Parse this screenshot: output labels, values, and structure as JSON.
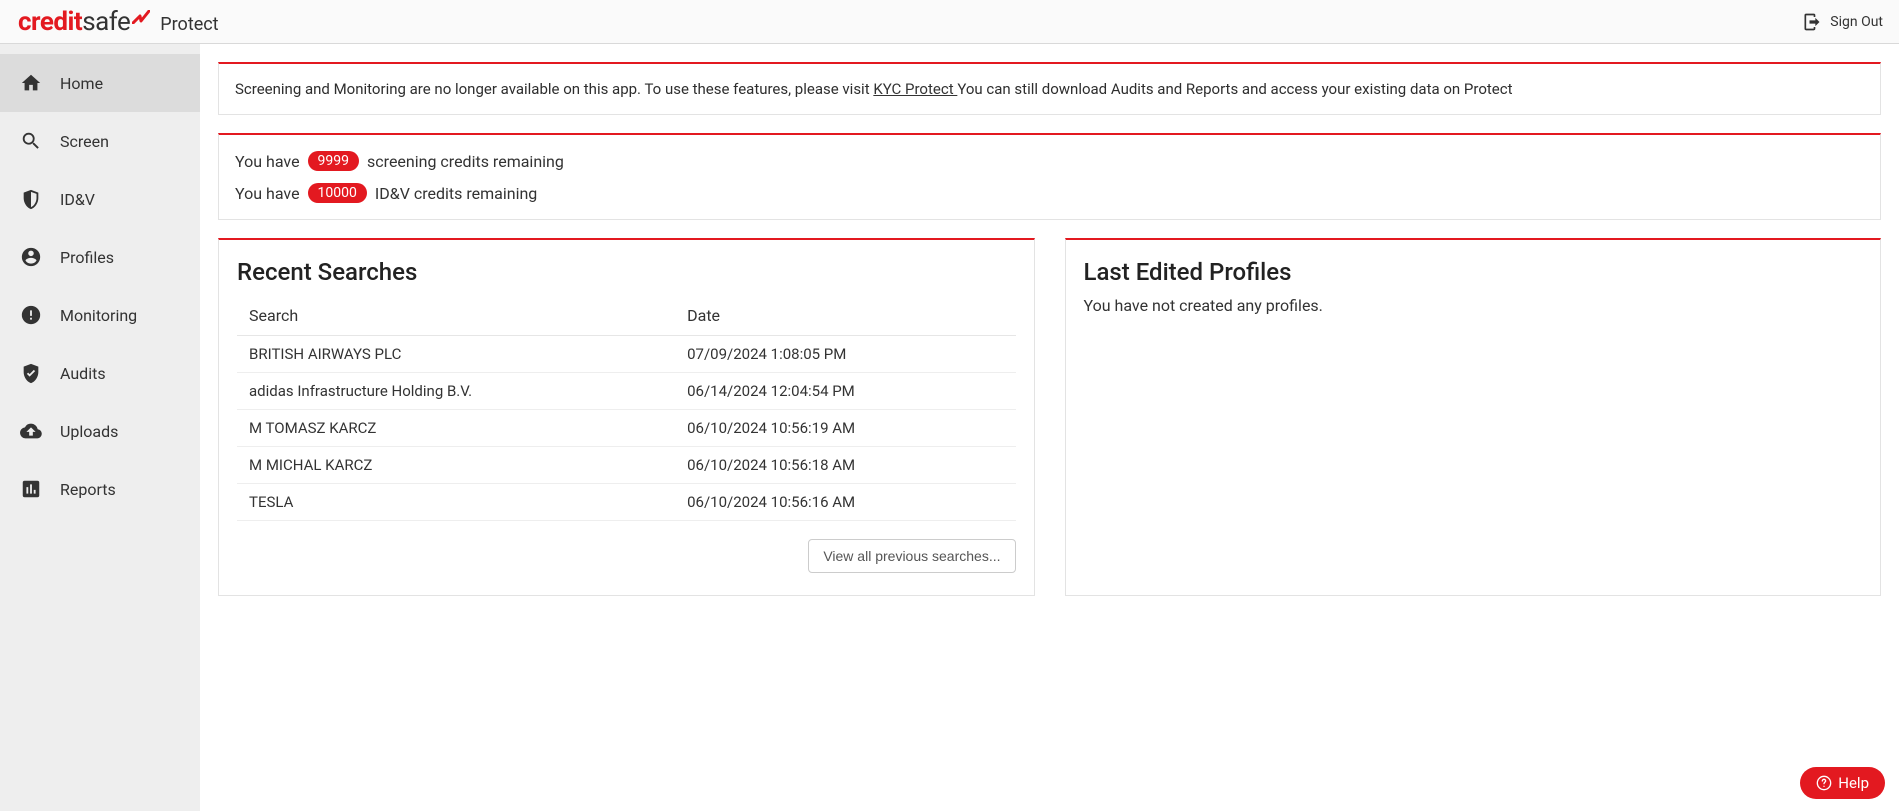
{
  "header": {
    "app_name": "Protect",
    "sign_out": "Sign Out"
  },
  "sidebar": [
    {
      "icon": "home",
      "label": "Home",
      "active": true
    },
    {
      "icon": "search",
      "label": "Screen",
      "active": false
    },
    {
      "icon": "shield",
      "label": "ID&V",
      "active": false
    },
    {
      "icon": "account",
      "label": "Profiles",
      "active": false
    },
    {
      "icon": "monitor",
      "label": "Monitoring",
      "active": false
    },
    {
      "icon": "audit",
      "label": "Audits",
      "active": false
    },
    {
      "icon": "upload",
      "label": "Uploads",
      "active": false
    },
    {
      "icon": "report",
      "label": "Reports",
      "active": false
    }
  ],
  "banner": {
    "pre_text": "Screening and Monitoring are no longer available on this app. To use these features, please visit ",
    "link_text": "KYC Protect ",
    "post_text": "You can still download Audits and Reports and access your existing data on Protect"
  },
  "credits": {
    "screening": {
      "prefix": "You have",
      "value": "9999",
      "suffix": "screening credits remaining"
    },
    "idv": {
      "prefix": "You have",
      "value": "10000",
      "suffix": "ID&V credits remaining"
    }
  },
  "recent": {
    "title": "Recent Searches",
    "columns": {
      "search": "Search",
      "date": "Date"
    },
    "rows": [
      {
        "search": "BRITISH AIRWAYS PLC",
        "date": "07/09/2024 1:08:05 PM"
      },
      {
        "search": "adidas Infrastructure Holding B.V.",
        "date": "06/14/2024 12:04:54 PM"
      },
      {
        "search": "M TOMASZ KARCZ",
        "date": "06/10/2024 10:56:19 AM"
      },
      {
        "search": "M MICHAL KARCZ",
        "date": "06/10/2024 10:56:18 AM"
      },
      {
        "search": "TESLA",
        "date": "06/10/2024 10:56:16 AM"
      }
    ],
    "view_all": "View all previous searches..."
  },
  "last_edited": {
    "title": "Last Edited Profiles",
    "message": "You have not created any profiles."
  },
  "help": {
    "label": "Help"
  }
}
